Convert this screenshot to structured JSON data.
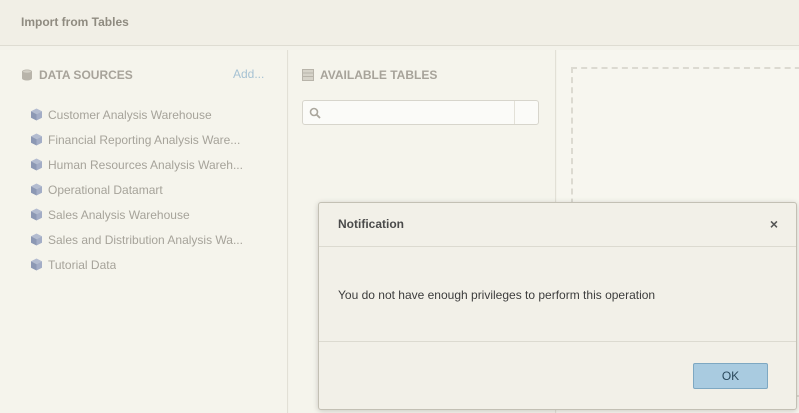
{
  "window": {
    "title": "Import from Tables"
  },
  "data_sources": {
    "header": "DATA SOURCES",
    "add_label": "Add...",
    "items": [
      {
        "label": "Customer Analysis Warehouse",
        "icon": "cube-icon"
      },
      {
        "label": "Financial Reporting Analysis Ware...",
        "icon": "cube-icon"
      },
      {
        "label": "Human Resources Analysis Wareh...",
        "icon": "cube-icon"
      },
      {
        "label": "Operational Datamart",
        "icon": "cube-icon"
      },
      {
        "label": "Sales Analysis Warehouse",
        "icon": "cube-icon"
      },
      {
        "label": "Sales and Distribution Analysis Wa...",
        "icon": "cube-icon"
      },
      {
        "label": "Tutorial Data",
        "icon": "cube-icon"
      }
    ]
  },
  "available_tables": {
    "header": "AVAILABLE TABLES",
    "search_value": ""
  },
  "dialog": {
    "title": "Notification",
    "close_glyph": "×",
    "message": "You do not have enough privileges to perform this operation",
    "ok_label": "OK"
  },
  "colors": {
    "accent_button": "#a9cbe0",
    "link": "#a6c2d3",
    "muted_text": "#a6a39a"
  }
}
